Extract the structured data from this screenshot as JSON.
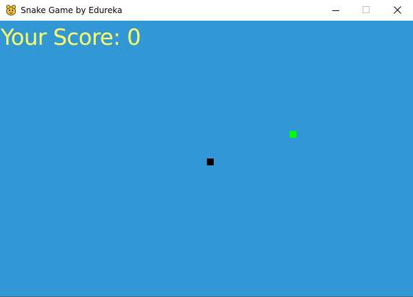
{
  "window": {
    "title": "Snake Game by Edureka",
    "icon": "pygame-snake-icon",
    "controls": [
      "minimize",
      "maximize",
      "close"
    ]
  },
  "game": {
    "score_label": "Your Score: 0",
    "score": 0,
    "colors": {
      "background": "#3298d5",
      "score_text": "#ffff66",
      "snake": "#000000",
      "food": "#00ff00"
    }
  }
}
